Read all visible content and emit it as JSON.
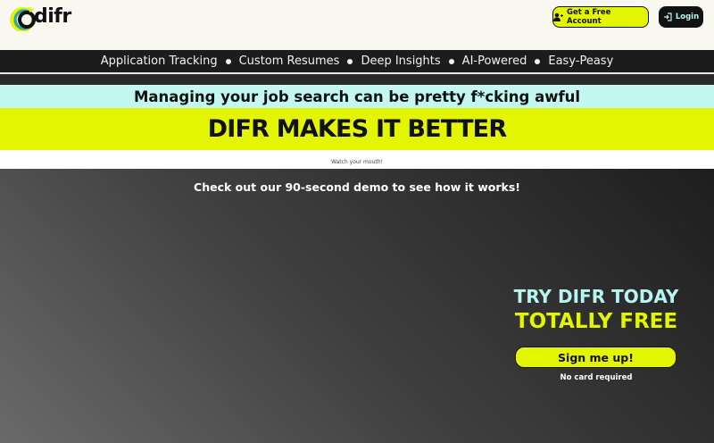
{
  "header": {
    "logo_text": "difr",
    "account_button": "Get a Free Account",
    "login_button": "Login",
    "account_icon": "user-plus-icon",
    "login_icon": "login-arrow-icon"
  },
  "features": {
    "items": [
      "Application Tracking",
      "Custom Resumes",
      "Deep Insights",
      "AI-Powered",
      "Easy-Peasy"
    ]
  },
  "hero": {
    "subtitle": "Managing your job search can be pretty f*cking awful",
    "headline": "DIFR MAKES IT BETTER",
    "note": "Watch your mouth!"
  },
  "demo": {
    "text": "Check out our 90-second demo to see how it works!"
  },
  "cta": {
    "line1": "TRY DIFR TODAY",
    "line2": "TOTALLY FREE",
    "button": "Sign me up!",
    "note": "No card required"
  },
  "colors": {
    "accent_yellow": "#e4f502",
    "accent_cyan": "#c3f7f2",
    "dark": "#1c1c1c"
  }
}
